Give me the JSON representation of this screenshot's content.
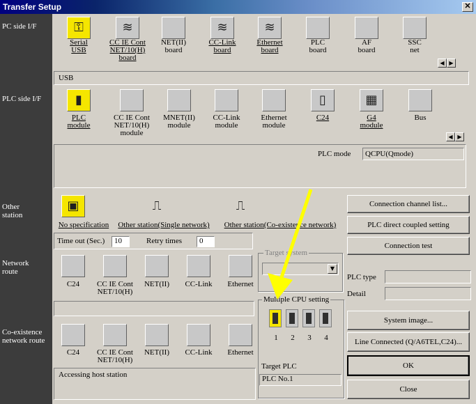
{
  "window": {
    "title": "Transfer Setup",
    "close_glyph": "✕"
  },
  "labels": {
    "pc_side": "PC side I/F",
    "plc_side": "PLC side I/F",
    "other_station": "Other station",
    "network_route": "Network route",
    "coexistence": "Co-existence network route"
  },
  "pc_side": {
    "items": [
      {
        "line1": "Serial",
        "line2": "USB",
        "icon": "serial-usb-icon"
      },
      {
        "line1": "CC IE Cont",
        "line2": "NET/10(H)",
        "line3": "board",
        "icon": "cc-ie-board-icon"
      },
      {
        "line1": "NET(II)",
        "line2": "board",
        "icon": "netii-board-icon"
      },
      {
        "line1": "CC-Link",
        "line2": "board",
        "icon": "cclink-board-icon"
      },
      {
        "line1": "Ethernet",
        "line2": "board",
        "icon": "ethernet-board-icon"
      },
      {
        "line1": "PLC",
        "line2": "board",
        "icon": "plc-board-icon"
      },
      {
        "line1": "AF",
        "line2": "board",
        "icon": "af-board-icon"
      },
      {
        "line1": "SSC",
        "line2": "net",
        "icon": "ssc-net-icon"
      }
    ],
    "status": "USB"
  },
  "plc_side": {
    "items": [
      {
        "line1": "PLC",
        "line2": "module"
      },
      {
        "line1": "CC IE Cont",
        "line2": "NET/10(H)",
        "line3": "module"
      },
      {
        "line1": "MNET(II)",
        "line2": "module"
      },
      {
        "line1": "CC-Link",
        "line2": "module"
      },
      {
        "line1": "Ethernet",
        "line2": "module"
      },
      {
        "line1": "C24",
        "line2": ""
      },
      {
        "line1": "G4",
        "line2": "module"
      },
      {
        "line1": "Bus",
        "line2": ""
      }
    ],
    "plc_mode_label": "PLC mode",
    "plc_mode_value": "QCPU(Qmode)"
  },
  "other_station": {
    "items": [
      "No specification",
      "Other station(Single network)",
      "Other station(Co-existence network)"
    ],
    "timeout_label": "Time out (Sec.)",
    "timeout_value": "10",
    "retry_label": "Retry times",
    "retry_value": "0"
  },
  "network_route": {
    "items": [
      {
        "line1": "C24",
        "line2": ""
      },
      {
        "line1": "CC IE Cont",
        "line2": "NET/10(H)"
      },
      {
        "line1": "NET(II)",
        "line2": ""
      },
      {
        "line1": "CC-Link",
        "line2": ""
      },
      {
        "line1": "Ethernet",
        "line2": ""
      }
    ]
  },
  "coexistence": {
    "items": [
      {
        "line1": "C24",
        "line2": ""
      },
      {
        "line1": "CC IE Cont",
        "line2": "NET/10(H)"
      },
      {
        "line1": "NET(II)",
        "line2": ""
      },
      {
        "line1": "CC-Link",
        "line2": ""
      },
      {
        "line1": "Ethernet",
        "line2": ""
      }
    ],
    "status": "Accessing host station"
  },
  "target_system": {
    "label": "Target system",
    "value": ""
  },
  "multiple_cpu": {
    "label": "Multiple CPU setting",
    "cpus": [
      "1",
      "2",
      "3",
      "4"
    ],
    "target_label": "Target PLC",
    "target_value": "PLC No.1"
  },
  "buttons": {
    "connection_channel": "Connection  channel  list...",
    "plc_direct": "PLC direct coupled setting",
    "connection_test": "Connection test",
    "system_image": "System    image...",
    "line_connected": "Line Connected  (Q/A6TEL,C24)...",
    "ok": "OK",
    "close": "Close"
  },
  "plc_type": {
    "label": "PLC type",
    "value": ""
  },
  "detail": {
    "label": "Detail",
    "value": ""
  },
  "colors": {
    "accent": "#f5e600",
    "arrow": "#ffff00",
    "dark_column": "#3c3c3c"
  }
}
